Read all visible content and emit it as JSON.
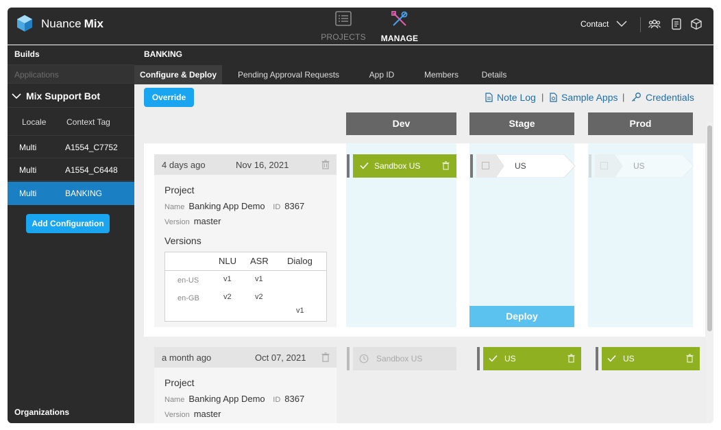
{
  "app": {
    "brand_first": "Nuance",
    "brand_second": "Mix"
  },
  "topnav": {
    "projects_label": "PROJECTS",
    "manage_label": "MANAGE",
    "contact_label": "Contact"
  },
  "sidebar": {
    "builds_label": "Builds",
    "applications_label": "Applications",
    "bot_name": "Mix Support Bot",
    "col_locale": "Locale",
    "col_context_tag": "Context Tag",
    "rows": [
      {
        "locale": "Multi",
        "tag": "A1554_C7752"
      },
      {
        "locale": "Multi",
        "tag": "A1554_C6448"
      },
      {
        "locale": "Multi",
        "tag": "BANKING"
      }
    ],
    "add_config_label": "Add Configuration",
    "organizations_label": "Organizations"
  },
  "header": {
    "app_title": "BANKING",
    "tabs": [
      {
        "label": "Configure & Deploy"
      },
      {
        "label": "Pending Approval Requests"
      },
      {
        "label": "App ID"
      },
      {
        "label": "Members"
      },
      {
        "label": "Details"
      }
    ]
  },
  "toolbar": {
    "override_label": "Override",
    "note_log_label": "Note Log",
    "sample_apps_label": "Sample Apps",
    "credentials_label": "Credentials",
    "sep": "|"
  },
  "environments": [
    "Dev",
    "Stage",
    "Prod"
  ],
  "builds": [
    {
      "ago": "4 days ago",
      "date": "Nov 16, 2021",
      "project_label": "Project",
      "name_key": "Name",
      "name_value": "Banking App Demo",
      "id_key": "ID",
      "id_value": "8367",
      "version_key": "Version",
      "version_value": "master",
      "versions_label": "Versions",
      "versions_table": {
        "headers": [
          "NLU",
          "ASR",
          "Dialog"
        ],
        "rows": [
          {
            "locale": "en-US",
            "nlu": "v1",
            "asr": "v1",
            "dialog": ""
          },
          {
            "locale": "en-GB",
            "nlu": "v2",
            "asr": "v2",
            "dialog": ""
          },
          {
            "locale": "",
            "nlu": "",
            "asr": "",
            "dialog": "v1"
          }
        ]
      },
      "dev": "Sandbox US",
      "stage": "US",
      "prod": "US",
      "deploy_label": "Deploy"
    },
    {
      "ago": "a month ago",
      "date": "Oct 07, 2021",
      "project_label": "Project",
      "name_key": "Name",
      "name_value": "Banking App Demo",
      "id_key": "ID",
      "id_value": "8367",
      "version_key": "Version",
      "version_value": "master",
      "dev": "Sandbox US",
      "stage": "US",
      "prod": "US"
    }
  ],
  "colors": {
    "accent": "#1aa5f0",
    "deployed": "#8fb021",
    "env_header": "#666666",
    "active_row": "#1b7fc4"
  }
}
